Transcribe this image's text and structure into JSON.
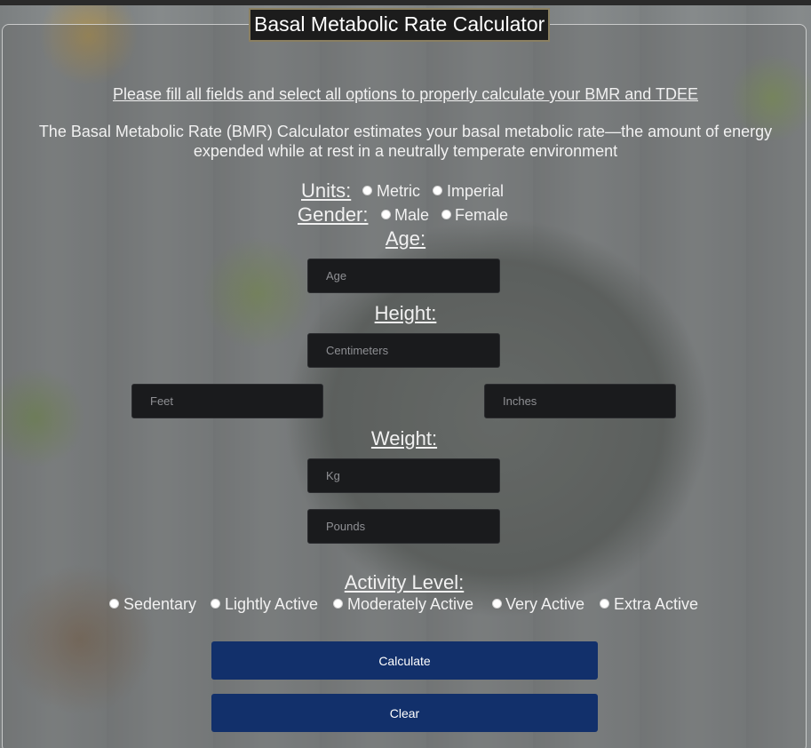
{
  "app": {
    "title": "Basal Metabolic Rate Calculator",
    "notice": "Please fill all fields and select all options to properly calculate your BMR and TDEE",
    "description": "The Basal Metabolic Rate (BMR) Calculator estimates your basal metabolic rate—the amount of energy expended while at rest in a neutrally temperate environment"
  },
  "units": {
    "label": "Units:",
    "options": [
      "Metric",
      "Imperial"
    ]
  },
  "gender": {
    "label": "Gender:",
    "options": [
      "Male",
      "Female"
    ]
  },
  "age": {
    "label": "Age:",
    "placeholder": "Age"
  },
  "height": {
    "label": "Height:",
    "cm_placeholder": "Centimeters",
    "feet_placeholder": "Feet",
    "inches_placeholder": "Inches"
  },
  "weight": {
    "label": "Weight:",
    "kg_placeholder": "Kg",
    "lb_placeholder": "Pounds"
  },
  "activity": {
    "label": "Activity Level:",
    "options": [
      "Sedentary",
      "Lightly Active",
      "Moderately Active",
      "Very Active",
      "Extra Active"
    ]
  },
  "buttons": {
    "calculate": "Calculate",
    "clear": "Clear"
  },
  "colors": {
    "button": "#12306b",
    "input_bg": "#1a1b1d",
    "text": "#f1f1f1"
  }
}
